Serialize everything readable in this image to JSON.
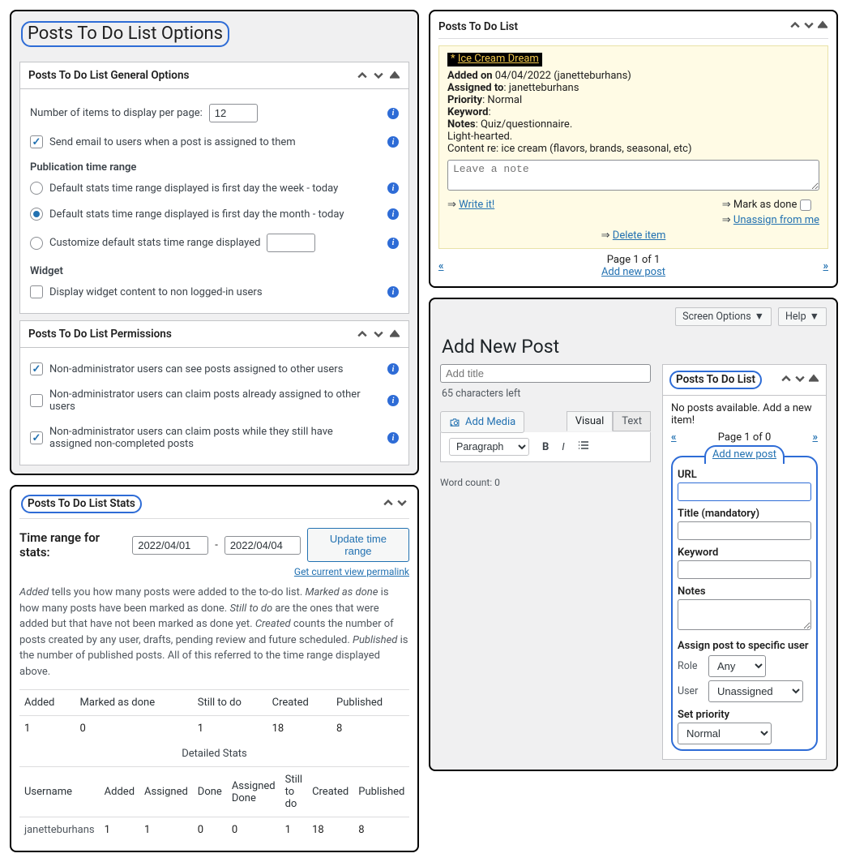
{
  "panel_options": {
    "title": "Posts To Do List Options",
    "general": {
      "title": "Posts To Do List General Options",
      "items_label": "Number of items to display per page:",
      "items_value": "12",
      "send_email_label": "Send email to users when a post is assigned to them",
      "time_range_heading": "Publication time range",
      "tr_week_label": "Default stats time range displayed is first day the week - today",
      "tr_month_label": "Default stats time range displayed is first day the month - today",
      "tr_custom_label": "Customize default stats time range displayed",
      "tr_custom_value": "",
      "widget_heading": "Widget",
      "widget_label": "Display widget content to non logged-in users"
    },
    "permissions": {
      "title": "Posts To Do List Permissions",
      "p1": "Non-administrator users can see posts assigned to other users",
      "p2": "Non-administrator users can claim posts already assigned to other users",
      "p3": "Non-administrator users can claim posts while they still have assigned non-completed posts"
    }
  },
  "panel_stats": {
    "title": "Posts To Do List Stats",
    "range_label": "Time range for stats:",
    "date_from": "2022/04/01",
    "date_sep": "-",
    "date_to": "2022/04/04",
    "update_btn": "Update time range",
    "permalink_link": "Get current view permalink",
    "desc_parts": {
      "d1": "Added",
      "d1t": " tells you how many posts were added to the to-do list. ",
      "d2": "Marked as done",
      "d2t": " is how many posts have been marked as done. ",
      "d3": "Still to do",
      "d3t": " are the ones that were added but that have not been marked as done yet. ",
      "d4": "Created",
      "d4t": " counts the number of posts created by any user, drafts, pending review and future scheduled. ",
      "d5": "Published",
      "d5t": " is the number of published posts. All of this referred to the time range displayed above."
    },
    "summary": {
      "headers": [
        "Added",
        "Marked as done",
        "Still to do",
        "Created",
        "Published"
      ],
      "row": [
        "1",
        "0",
        "1",
        "18",
        "8"
      ]
    },
    "detailed_title": "Detailed Stats",
    "detailed": {
      "headers": [
        "Username",
        "Added",
        "Assigned",
        "Done",
        "Assigned Done",
        "Still to do",
        "Created",
        "Published"
      ],
      "row": [
        "janetteburhans",
        "1",
        "1",
        "0",
        "0",
        "1",
        "18",
        "8"
      ]
    }
  },
  "panel_todo_box": {
    "title": "Posts To Do List",
    "item": {
      "star": "* ",
      "post_title": "Ice Cream Dream",
      "added_on_label": "Added on",
      "added_on_val": " 04/04/2022 (janetteburhans)",
      "assigned_label": "Assigned to",
      "assigned_val": ": janetteburhans",
      "priority_label": "Priority",
      "priority_val": ": Normal",
      "keyword_label": "Keyword",
      "keyword_val": ":",
      "notes_label": "Notes",
      "notes_val": ": Quiz/questionnaire.",
      "line2": "Light-hearted.",
      "line3": "Content re: ice cream (flavors, brands, seasonal, etc)",
      "note_placeholder": "Leave a note",
      "write_it": "Write it!",
      "mark_done": "Mark as done",
      "unassign": "Unassign from me",
      "delete": "Delete item"
    },
    "pagination": {
      "prev": "«",
      "next": "»",
      "text": "Page 1 of 1",
      "add": "Add new post"
    }
  },
  "panel_addnew": {
    "screen_options": "Screen Options",
    "help": "Help",
    "heading": "Add New Post",
    "title_placeholder": "Add title",
    "chars_left": "65 characters left",
    "add_media": "Add Media",
    "tab_visual": "Visual",
    "tab_text": "Text",
    "paragraph": "Paragraph",
    "word_count": "Word count: 0",
    "sidebox": {
      "title": "Posts To Do List",
      "empty": "No posts available. Add a new item!",
      "page": "Page 1 of 0",
      "prev": "«",
      "next": "»",
      "add": "Add new post",
      "url_label": "URL",
      "title_label": "Title (mandatory)",
      "keyword_label": "Keyword",
      "notes_label": "Notes",
      "assign_label": "Assign post to specific user",
      "role_lbl": "Role",
      "role_val": "Any",
      "user_lbl": "User",
      "user_val": "Unassigned",
      "priority_label": "Set priority",
      "priority_val": "Normal"
    }
  }
}
